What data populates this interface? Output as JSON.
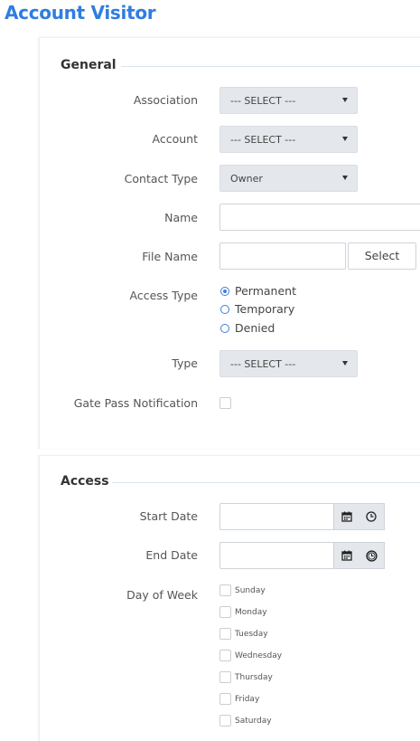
{
  "page": {
    "title": "Account Visitor"
  },
  "general": {
    "heading": "General",
    "association": {
      "label": "Association",
      "value": "--- SELECT ---"
    },
    "account": {
      "label": "Account",
      "value": "--- SELECT ---"
    },
    "contact_type": {
      "label": "Contact Type",
      "value": "Owner"
    },
    "name": {
      "label": "Name",
      "value": ""
    },
    "file_name": {
      "label": "File Name",
      "value": "",
      "button": "Select"
    },
    "access_type": {
      "label": "Access Type",
      "options": [
        "Permanent",
        "Temporary",
        "Denied"
      ],
      "selected": "Permanent"
    },
    "type": {
      "label": "Type",
      "value": "--- SELECT ---"
    },
    "gate_pass": {
      "label": "Gate Pass Notification",
      "checked": false
    }
  },
  "access": {
    "heading": "Access",
    "start_date": {
      "label": "Start Date",
      "value": ""
    },
    "end_date": {
      "label": "End Date",
      "value": ""
    },
    "day_of_week": {
      "label": "Day of Week",
      "days": [
        "Sunday",
        "Monday",
        "Tuesday",
        "Wednesday",
        "Thursday",
        "Friday",
        "Saturday"
      ]
    }
  },
  "icons": {
    "calendar": "calendar-icon",
    "clock": "clock-icon",
    "caret": "caret-down-icon"
  },
  "colors": {
    "accent": "#2f7de1",
    "radio": "#3f7be0",
    "select_bg": "#e4e7eb"
  }
}
